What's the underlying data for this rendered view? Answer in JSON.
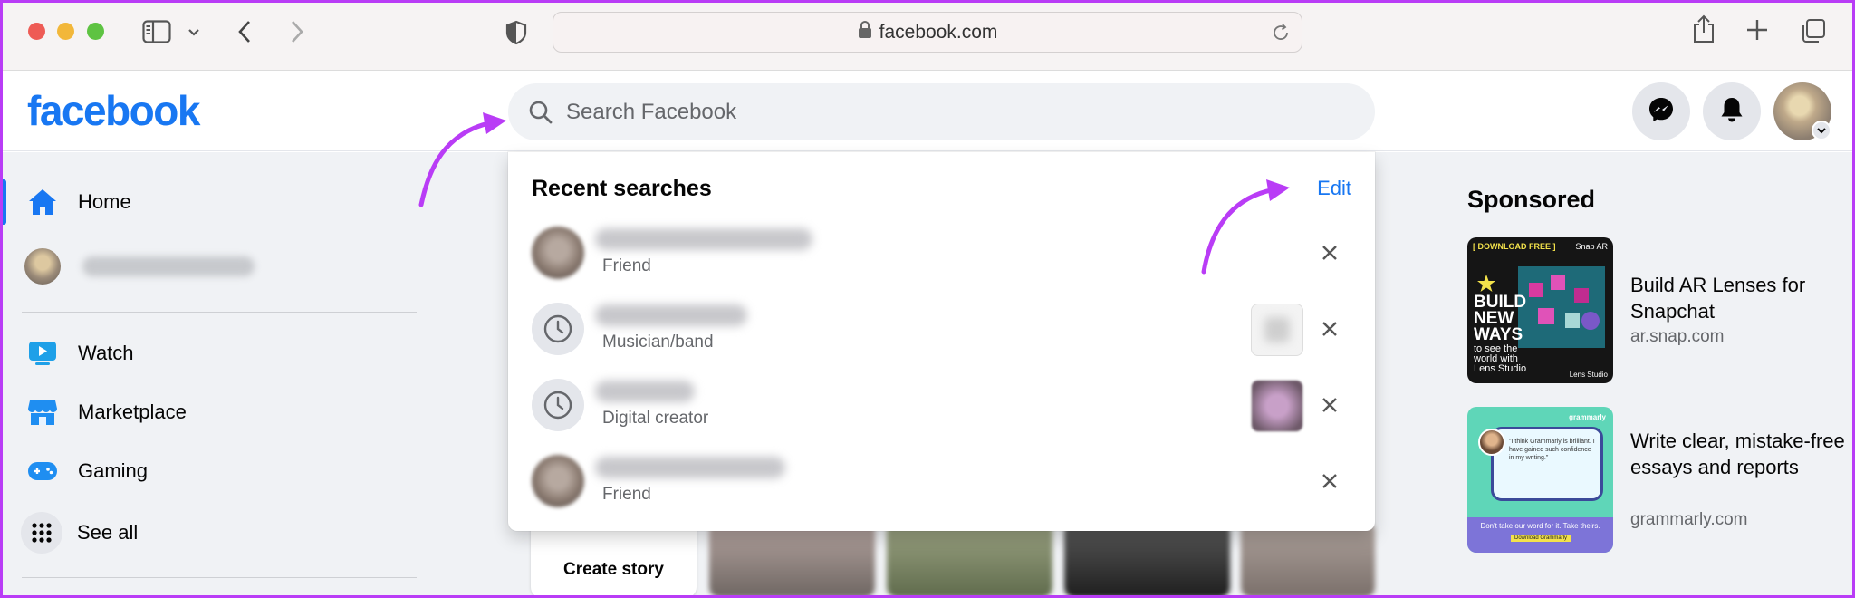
{
  "browser": {
    "url": "facebook.com",
    "icons": [
      "sidebar-icon",
      "chevron-down-icon",
      "back-icon",
      "forward-icon",
      "shield-icon",
      "lock-icon",
      "reload-icon",
      "share-icon",
      "new-tab-icon",
      "tabs-overview-icon"
    ]
  },
  "header": {
    "logo": "facebook",
    "search": {
      "placeholder": "Search Facebook",
      "value": ""
    },
    "icons": [
      "messenger-icon",
      "notifications-icon",
      "profile-avatar"
    ]
  },
  "sidebar": {
    "items": [
      {
        "label": "Home",
        "icon": "home-icon"
      },
      {
        "label": "",
        "icon": "user-avatar"
      },
      {
        "label": "Watch",
        "icon": "watch-icon"
      },
      {
        "label": "Marketplace",
        "icon": "marketplace-icon"
      },
      {
        "label": "Gaming",
        "icon": "gaming-icon"
      },
      {
        "label": "See all",
        "icon": "grid-icon"
      }
    ]
  },
  "dropdown": {
    "title": "Recent searches",
    "edit_label": "Edit",
    "items": [
      {
        "subtitle": "Friend",
        "thumb": "profile-photo"
      },
      {
        "subtitle": "Musician/band",
        "thumb": "clock-icon"
      },
      {
        "subtitle": "Digital creator",
        "thumb": "clock-icon"
      },
      {
        "subtitle": "Friend",
        "thumb": "profile-photo"
      }
    ]
  },
  "stories": {
    "create_label": "Create story"
  },
  "sponsored": {
    "title": "Sponsored",
    "ads": [
      {
        "title": "Build AR Lenses for Snapchat",
        "domain": "ar.snap.com",
        "image_text": {
          "tag": "[ DOWNLOAD FREE ]",
          "brand": "Snap AR",
          "headline": "BUILD NEW WAYS",
          "sub": "to see the world with Lens Studio",
          "footer": "Lens Studio"
        }
      },
      {
        "title": "Write clear, mistake-free essays and reports",
        "domain": "grammarly.com",
        "image_text": {
          "brand": "grammarly",
          "quote": "\"I think Grammarly is brilliant. I have gained such confidence in my writing.\"",
          "footer": "Don't take our word for it. Take theirs.",
          "cta": "Download Grammarly"
        }
      }
    ]
  },
  "colors": {
    "fb_blue": "#1877f2",
    "annotation_purple": "#b93cf6",
    "bg_gray": "#f0f2f5"
  }
}
